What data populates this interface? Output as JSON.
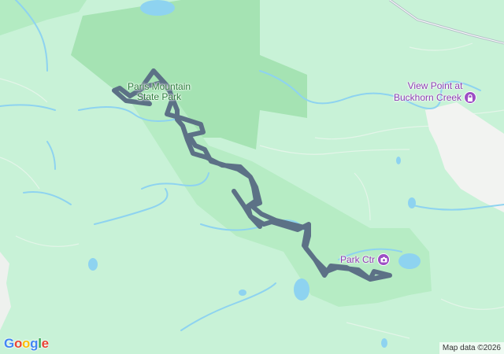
{
  "map": {
    "colors": {
      "land": "#c8f2d7",
      "park_dark": "#a5e3b3",
      "park_light": "#b6ecc4",
      "water": "#8ed3f0",
      "trail": "#5c7186",
      "poi": "#9c4fc4",
      "park_text": "#2f7d3e",
      "poi_text": "#8e3fb3"
    },
    "labels": {
      "park_name_line1": "Paris Mountain",
      "park_name_line2": "State Park",
      "view_point_line1": "View Point at",
      "view_point_line2": "Buckhorn Creek",
      "park_center": "Park Ctr"
    },
    "icons": {
      "view_point": "lock-icon",
      "park_center": "camera-icon"
    },
    "branding": {
      "logo_text": "Google",
      "logo_colors": [
        "#4285f4",
        "#ea4335",
        "#fbbc05",
        "#4285f4",
        "#34a853",
        "#ea4335"
      ],
      "attribution": "Map data ©2026"
    }
  }
}
